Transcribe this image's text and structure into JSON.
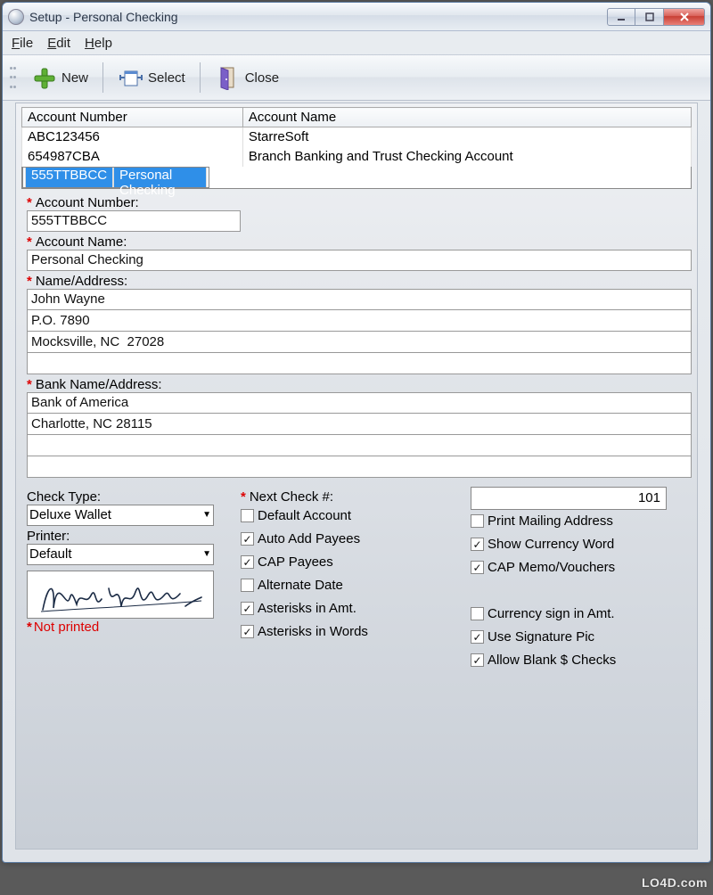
{
  "window": {
    "title": "Setup - Personal Checking"
  },
  "menu": {
    "file": "File",
    "edit": "Edit",
    "help": "Help"
  },
  "toolbar": {
    "new": "New",
    "select": "Select",
    "close": "Close"
  },
  "table": {
    "headers": {
      "acct_no": "Account Number",
      "acct_name": "Account Name"
    },
    "rows": [
      {
        "no": "ABC123456",
        "name": "StarreSoft",
        "selected": false
      },
      {
        "no": "654987CBA",
        "name": "Branch Banking and Trust Checking Account",
        "selected": false
      },
      {
        "no": "555TTBBCC",
        "name": "Personal Checking",
        "selected": true
      }
    ]
  },
  "labels": {
    "acct_no": "Account Number:",
    "acct_name": "Account Name:",
    "name_addr": "Name/Address:",
    "bank_addr": "Bank Name/Address:",
    "check_type": "Check Type:",
    "printer": "Printer:",
    "next_check": "Next Check #:",
    "not_printed": "Not printed",
    "req": "*"
  },
  "fields": {
    "acct_no": "555TTBBCC",
    "acct_name": "Personal Checking",
    "addr1": "John Wayne",
    "addr2": "P.O. 7890",
    "addr3": "Mocksville, NC  27028",
    "addr4": "",
    "bank1": "Bank of America",
    "bank2": "Charlotte, NC 28115",
    "bank3": "",
    "bank4": "",
    "check_type": "Deluxe Wallet",
    "printer": "Default",
    "next_check": "101",
    "signature_name": "John Wayne"
  },
  "checks_mid": [
    {
      "label": "Default Account",
      "checked": false
    },
    {
      "label": "Auto Add Payees",
      "checked": true
    },
    {
      "label": "CAP Payees",
      "checked": true
    },
    {
      "label": "Alternate Date",
      "checked": false
    },
    {
      "label": "Asterisks in Amt.",
      "checked": true
    },
    {
      "label": "Asterisks in Words",
      "checked": true
    }
  ],
  "checks_right": [
    {
      "label": "Print Mailing Address",
      "checked": false
    },
    {
      "label": "Show Currency Word",
      "checked": true
    },
    {
      "label": "CAP Memo/Vouchers",
      "checked": true
    },
    {
      "label": "",
      "checked": null
    },
    {
      "label": "Currency sign in Amt.",
      "checked": false
    },
    {
      "label": "Use Signature Pic",
      "checked": true
    },
    {
      "label": "Allow Blank $ Checks",
      "checked": true
    }
  ],
  "watermark": "LO4D.com"
}
